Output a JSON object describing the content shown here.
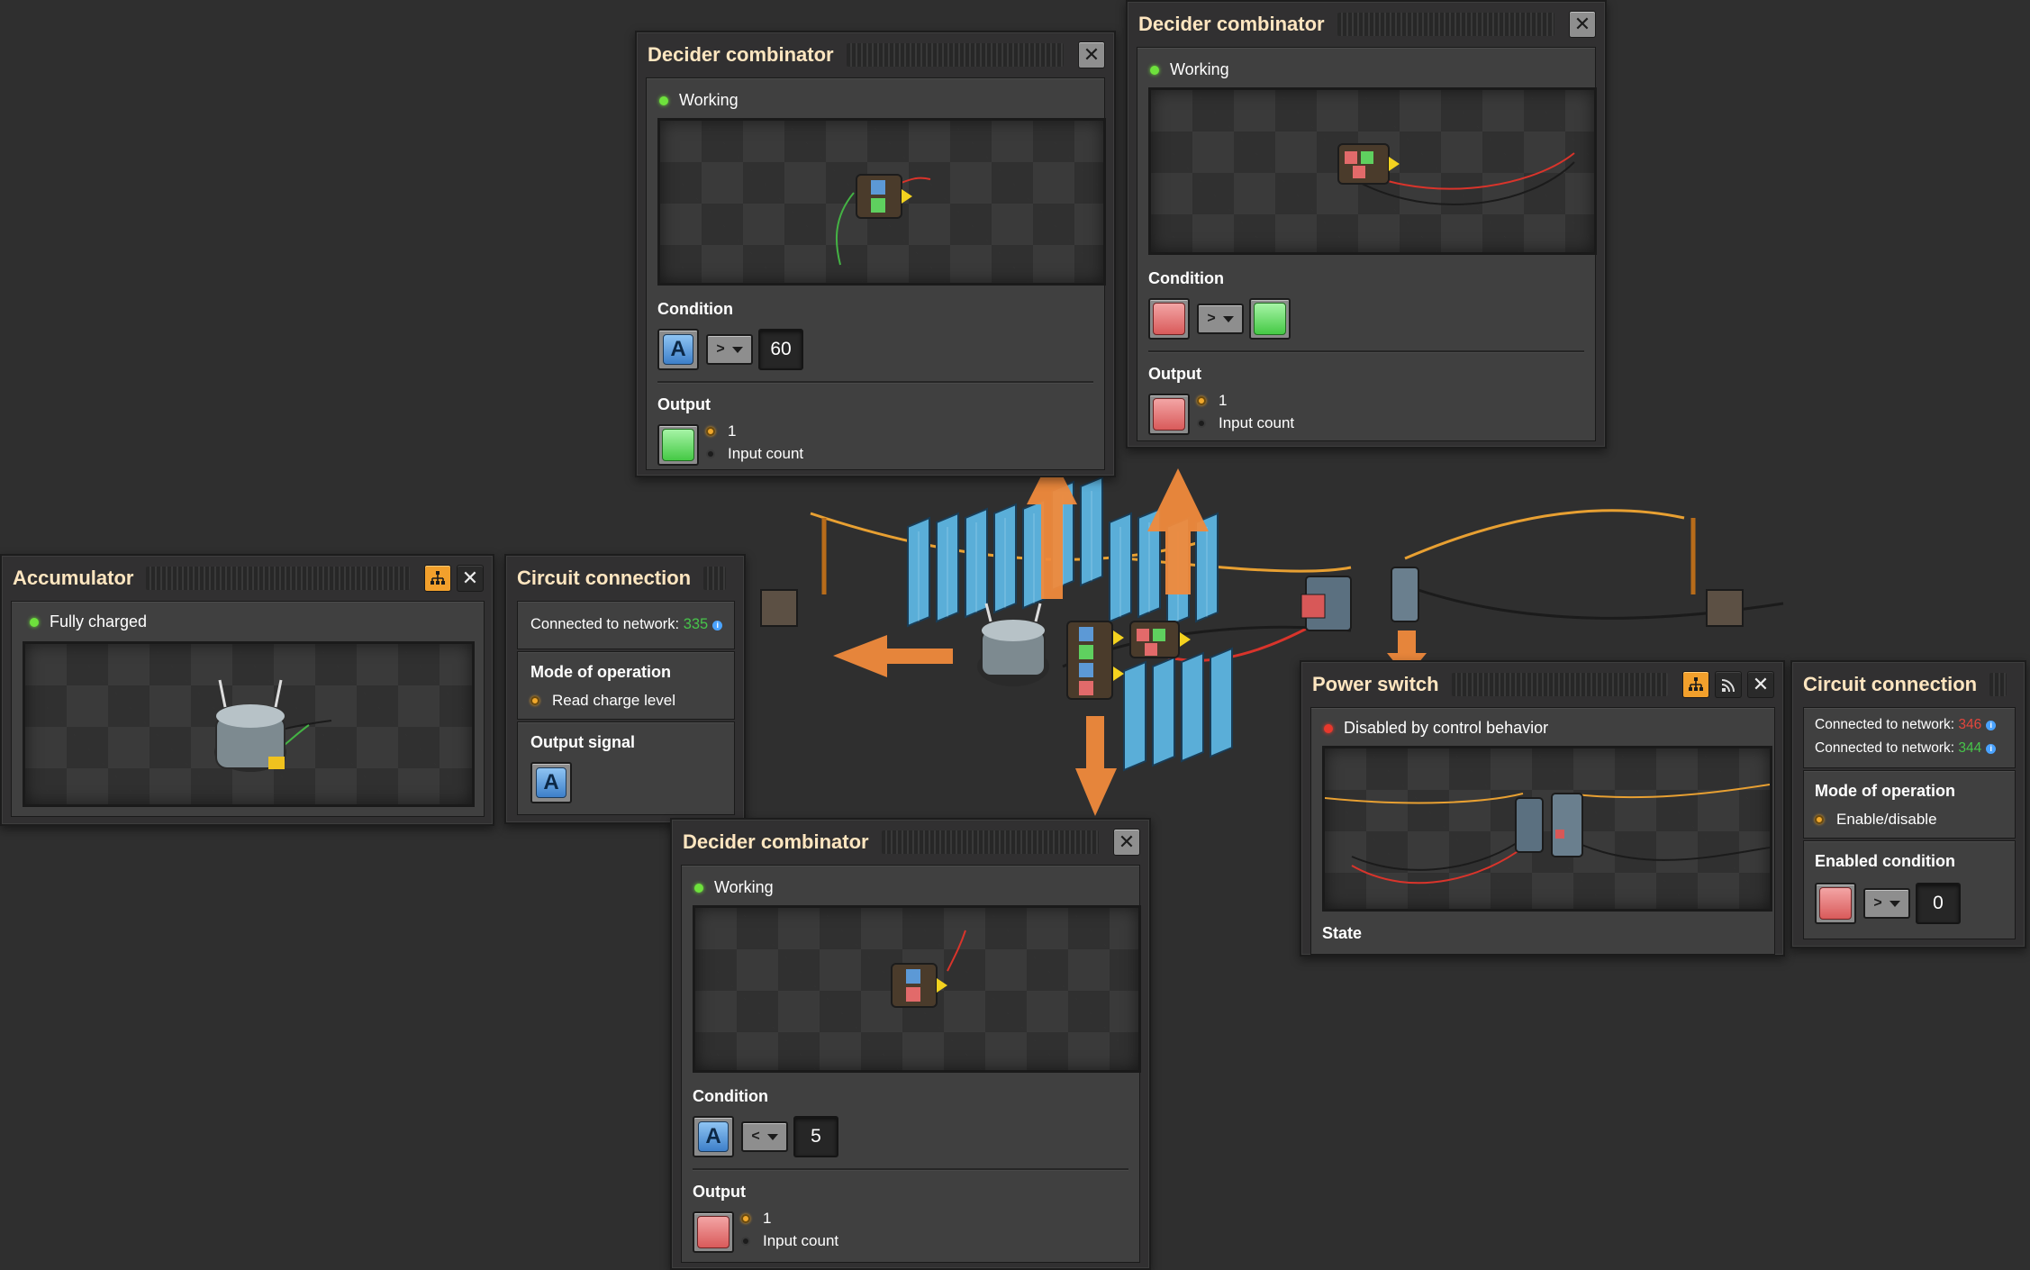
{
  "decider_top_left": {
    "title": "Decider combinator",
    "status": "Working",
    "condition_label": "Condition",
    "condition_signal": "A",
    "comparator": ">",
    "constant": "60",
    "output_label": "Output",
    "output_option_1": "1",
    "output_option_2": "Input count"
  },
  "decider_top_right": {
    "title": "Decider combinator",
    "status": "Working",
    "condition_label": "Condition",
    "comparator": ">",
    "output_label": "Output",
    "output_option_1": "1",
    "output_option_2": "Input count"
  },
  "decider_bottom": {
    "title": "Decider combinator",
    "status": "Working",
    "condition_label": "Condition",
    "condition_signal": "A",
    "comparator": "<",
    "constant": "5",
    "output_label": "Output",
    "output_option_1": "1",
    "output_option_2": "Input count"
  },
  "accumulator": {
    "title": "Accumulator",
    "status": "Fully charged"
  },
  "circuit_left": {
    "title": "Circuit connection",
    "connected_label": "Connected to network:",
    "network_id": "335",
    "mode_label": "Mode of operation",
    "mode_option": "Read charge level",
    "output_signal_label": "Output signal",
    "output_signal": "A"
  },
  "power_switch": {
    "title": "Power switch",
    "status": "Disabled by control behavior",
    "state_label": "State"
  },
  "circuit_right": {
    "title": "Circuit connection",
    "connected_label_1": "Connected to network:",
    "network_red": "346",
    "connected_label_2": "Connected to network:",
    "network_green": "344",
    "mode_label": "Mode of operation",
    "mode_option": "Enable/disable",
    "enabled_condition_label": "Enabled condition",
    "comparator": ">",
    "constant": "0"
  },
  "colors": {
    "title_text": "#ffe6c0",
    "panel_bg": "#313031",
    "arrow_orange": "#f08a3c",
    "signal_red": "#d95a5a",
    "signal_green": "#45c945",
    "signal_blue": "#3d7fc9",
    "network_red": "#e2463c",
    "network_green": "#47c44a"
  }
}
